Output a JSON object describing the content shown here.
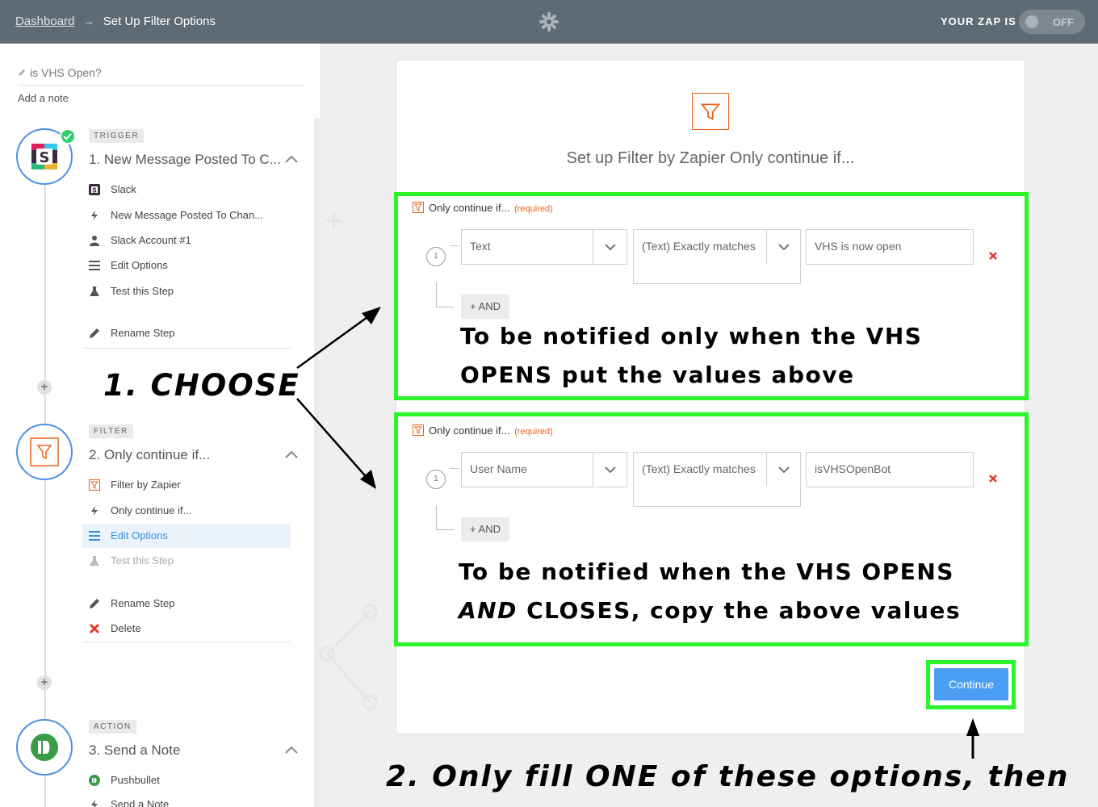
{
  "header": {
    "breadcrumb_link": "Dashboard",
    "breadcrumb_sep": "→",
    "breadcrumb_current": "Set Up Filter Options",
    "zap_label": "YOUR ZAP IS",
    "toggle_state": "OFF"
  },
  "sidebar": {
    "zap_name": "is VHS Open?",
    "add_note": "Add a note",
    "steps": [
      {
        "badge": "TRIGGER",
        "title": "1. New Message Posted To C...",
        "items": [
          {
            "label": "Slack",
            "icon": "slack-icon"
          },
          {
            "label": "New Message Posted To Chan...",
            "icon": "bolt-icon"
          },
          {
            "label": "Slack Account #1",
            "icon": "user-icon"
          },
          {
            "label": "Edit Options",
            "icon": "list-icon"
          },
          {
            "label": "Test this Step",
            "icon": "flask-icon"
          }
        ],
        "rename": "Rename Step"
      },
      {
        "badge": "FILTER",
        "title": "2. Only continue if...",
        "items": [
          {
            "label": "Filter by Zapier",
            "icon": "filter-icon"
          },
          {
            "label": "Only continue if...",
            "icon": "bolt-icon"
          },
          {
            "label": "Edit Options",
            "icon": "list-icon"
          },
          {
            "label": "Test this Step",
            "icon": "flask-icon"
          }
        ],
        "rename": "Rename Step",
        "delete": "Delete"
      },
      {
        "badge": "ACTION",
        "title": "3. Send a Note",
        "items": [
          {
            "label": "Pushbullet",
            "icon": "pushbullet-icon"
          },
          {
            "label": "Send a Note",
            "icon": "bolt-icon"
          }
        ]
      }
    ]
  },
  "main": {
    "title": "Set up Filter by Zapier Only continue if...",
    "rules": [
      {
        "header": "Only continue if...",
        "required": "(required)",
        "number": "1",
        "field": "Text",
        "condition": "(Text) Exactly matches",
        "value": "VHS is now open",
        "and_label": "+ AND",
        "annotation_line1": "To be notified only when the VHS",
        "annotation_line2": "OPENS put the values above"
      },
      {
        "header": "Only continue if...",
        "required": "(required)",
        "number": "1",
        "field": "User Name",
        "condition": "(Text) Exactly matches",
        "value": "isVHSOpenBot",
        "and_label": "+ AND",
        "annotation_line1": "To be notified when the VHS OPENS",
        "annotation_line2_italic": "AND",
        "annotation_line2_rest": " CLOSES, copy the above values"
      }
    ],
    "continue_label": "Continue"
  },
  "annotations": {
    "choose": "1. CHOOSE",
    "bottom": "2. Only fill ONE of these options, then"
  },
  "colors": {
    "topbar": "#5f6b74",
    "accent_blue": "#499df3",
    "highlight_green": "#2af42a",
    "zapier_orange": "#e8631f",
    "delete_red": "#e23b2a"
  }
}
